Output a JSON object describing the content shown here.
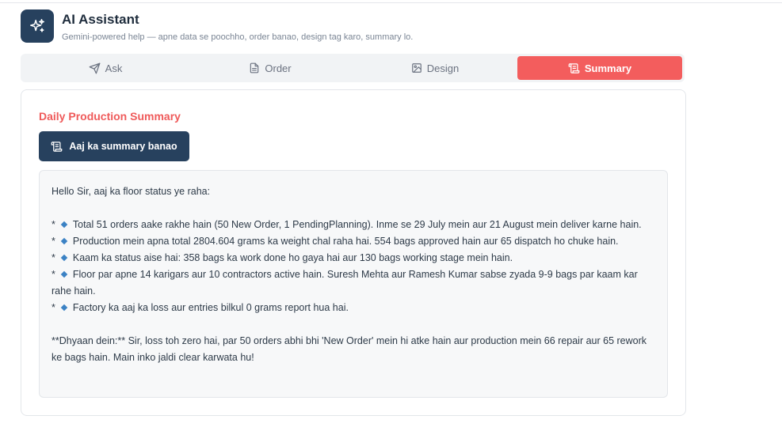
{
  "app": {
    "title": "AI Assistant",
    "subtitle": "Gemini-powered help — apne data se poochho, order banao, design tag karo, summary lo.",
    "logo_icon": "sparkles-icon"
  },
  "tabs": [
    {
      "label": "Ask",
      "icon": "send-icon",
      "active": false
    },
    {
      "label": "Order",
      "icon": "document-icon",
      "active": false
    },
    {
      "label": "Design",
      "icon": "image-icon",
      "active": false
    },
    {
      "label": "Summary",
      "icon": "scroll-icon",
      "active": true
    }
  ],
  "summary": {
    "heading": "Daily Production Summary",
    "button_label": "Aaj ka summary banao",
    "greeting": "Hello Sir, aaj ka floor status ye raha:",
    "bullet_marker": "*",
    "bullets": [
      "Total 51 orders aake rakhe hain (50 New Order, 1 PendingPlanning). Inme se 29 July mein aur 21 August mein deliver karne hain.",
      "Production mein apna total 2804.604 grams ka weight chal raha hai. 554 bags approved hain aur 65 dispatch ho chuke hain.",
      "Kaam ka status aise hai: 358 bags ka work done ho gaya hai aur 130 bags working stage mein hain.",
      "Floor par apne 14 karigars aur 10 contractors active hain. Suresh Mehta aur Ramesh Kumar sabse zyada 9-9 bags par kaam kar rahe hain.",
      "Factory ka aaj ka loss aur entries bilkul 0 grams report hua hai."
    ],
    "note": "**Dhyaan dein:** Sir, loss toh zero hai, par 50 orders abhi bhi 'New Order' mein hi atke hain aur production mein 66 repair aur 65 rework ke bags hain. Main inko jaldi clear karwata hu!"
  },
  "colors": {
    "brand_dark": "#27415e",
    "accent_red": "#f35d5d",
    "bullet_blue": "#3b82c4"
  }
}
